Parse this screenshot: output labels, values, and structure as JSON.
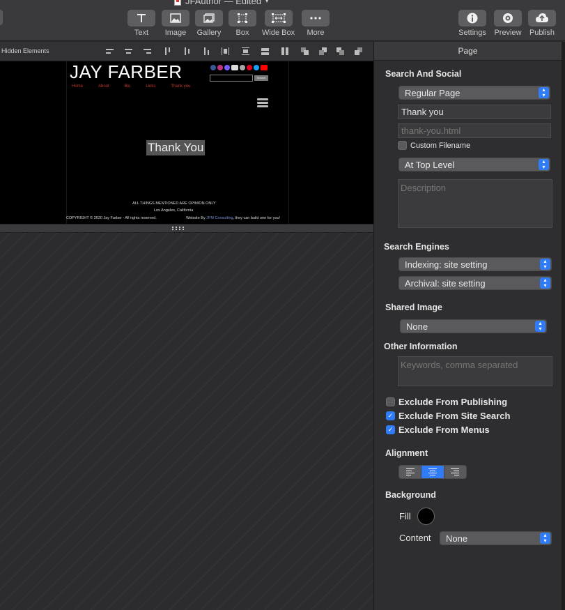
{
  "window": {
    "title": "JFAuthor — Edited"
  },
  "toolbar": {
    "left_items": [
      {
        "label": "Text",
        "icon": "text-icon"
      },
      {
        "label": "Image",
        "icon": "image-icon"
      },
      {
        "label": "Gallery",
        "icon": "gallery-icon"
      },
      {
        "label": "Box",
        "icon": "box-icon"
      },
      {
        "label": "Wide Box",
        "icon": "wide-box-icon"
      },
      {
        "label": "More",
        "icon": "more-icon"
      }
    ],
    "right_items": [
      {
        "label": "Settings",
        "icon": "info-icon"
      },
      {
        "label": "Preview",
        "icon": "eye-icon"
      },
      {
        "label": "Publish",
        "icon": "cloud-upload-icon"
      }
    ]
  },
  "canvas": {
    "hidden_elements_label": "Hidden Elements",
    "preview": {
      "site_title": "JAY FARBER",
      "nav": [
        "Home",
        "About",
        "Bio",
        "Links",
        "Thank you"
      ],
      "search_button": "Search",
      "heading": "Thank You",
      "footer_opinion": "ALL THINGS MENTIONED ARE OPINION ONLY",
      "footer_location": "Los Angeles, California",
      "footer_copyright": "COPYRIGHT © 2020 Jay Farber - All rights reserved.",
      "footer_website_prefix": "Website By",
      "footer_website_link": "JFM Consulting",
      "footer_website_suffix": ", they can build one for you!"
    }
  },
  "inspector": {
    "header": "Page",
    "search_social": {
      "title": "Search And Social",
      "page_type": "Regular Page",
      "page_title_value": "Thank you",
      "filename_placeholder": "thank-you.html",
      "custom_filename_label": "Custom Filename",
      "custom_filename_checked": false,
      "level": "At Top Level",
      "description_placeholder": "Description"
    },
    "search_engines": {
      "title": "Search Engines",
      "indexing": "Indexing: site setting",
      "archival": "Archival: site setting"
    },
    "shared_image": {
      "title": "Shared Image",
      "value": "None"
    },
    "other_info": {
      "title": "Other Information",
      "keywords_placeholder": "Keywords, comma separated"
    },
    "exclusions": [
      {
        "label": "Exclude From Publishing",
        "checked": false
      },
      {
        "label": "Exclude From Site Search",
        "checked": true
      },
      {
        "label": "Exclude From Menus",
        "checked": true
      }
    ],
    "alignment": {
      "title": "Alignment",
      "selected": "center"
    },
    "background": {
      "title": "Background",
      "fill_label": "Fill",
      "fill_color": "#000000",
      "content_label": "Content",
      "content_value": "None"
    }
  },
  "colors": {
    "accent": "#2f7cf6",
    "nav_link": "#c0392b"
  }
}
